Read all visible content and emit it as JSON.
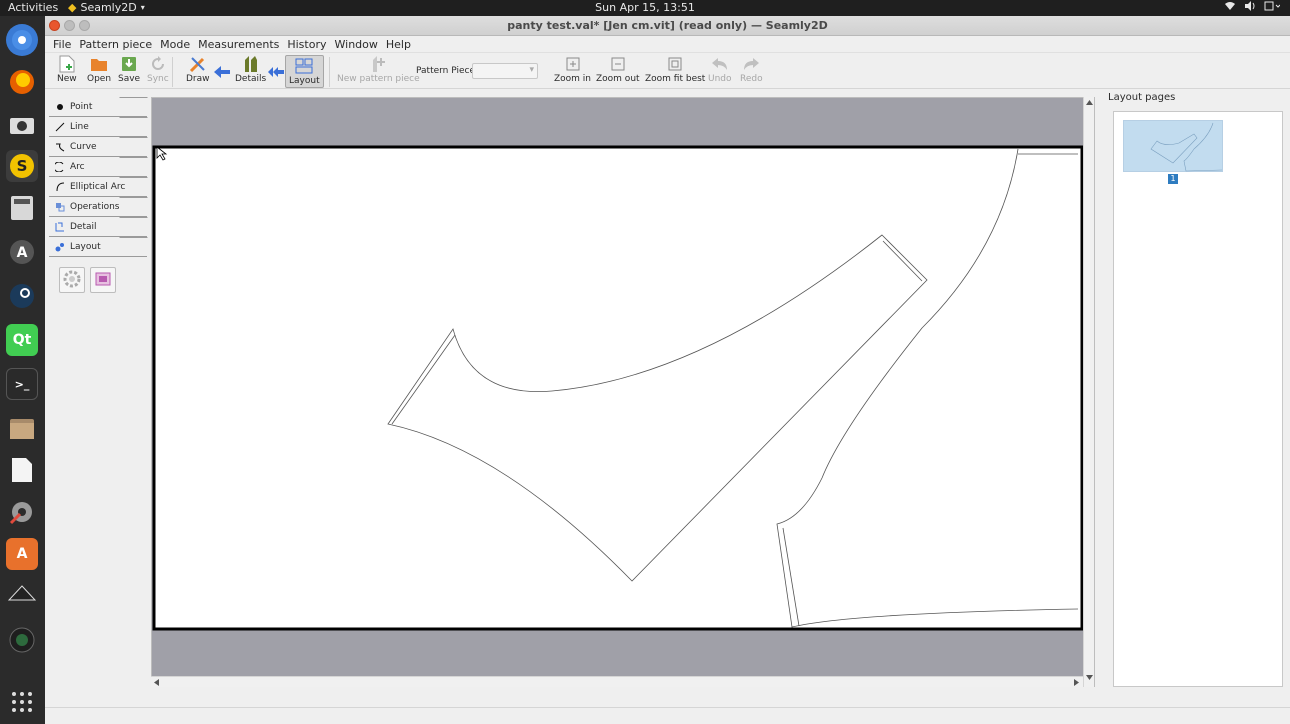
{
  "topbar": {
    "activities": "Activities",
    "app_name": "Seamly2D",
    "clock": "Sun Apr 15, 13:51"
  },
  "window": {
    "title": "panty test.val* [Jen cm.vit] (read only) — Seamly2D"
  },
  "menu": {
    "file": "File",
    "pattern_piece": "Pattern piece",
    "mode": "Mode",
    "measurements": "Measurements",
    "history": "History",
    "window": "Window",
    "help": "Help"
  },
  "toolbar": {
    "new": "New",
    "open": "Open",
    "save": "Save",
    "sync": "Sync",
    "draw": "Draw",
    "details": "Details",
    "layout": "Layout",
    "new_pattern_piece": "New pattern piece",
    "pattern_piece_label": "Pattern Piece:",
    "zoom_in": "Zoom in",
    "zoom_out": "Zoom out",
    "zoom_fit_best": "Zoom fit best",
    "undo": "Undo",
    "redo": "Redo"
  },
  "tools": {
    "point": "Point",
    "line": "Line",
    "curve": "Curve",
    "arc": "Arc",
    "elliptical_arc": "Elliptical Arc",
    "operations": "Operations",
    "detail": "Detail",
    "layout": "Layout"
  },
  "layout_pages": {
    "title": "Layout pages",
    "pages": [
      "1"
    ]
  },
  "colors": {
    "canvas_bg": "#a0a0a8",
    "thumb_bg": "#c2dcef",
    "accent": "#2e7cc0"
  }
}
